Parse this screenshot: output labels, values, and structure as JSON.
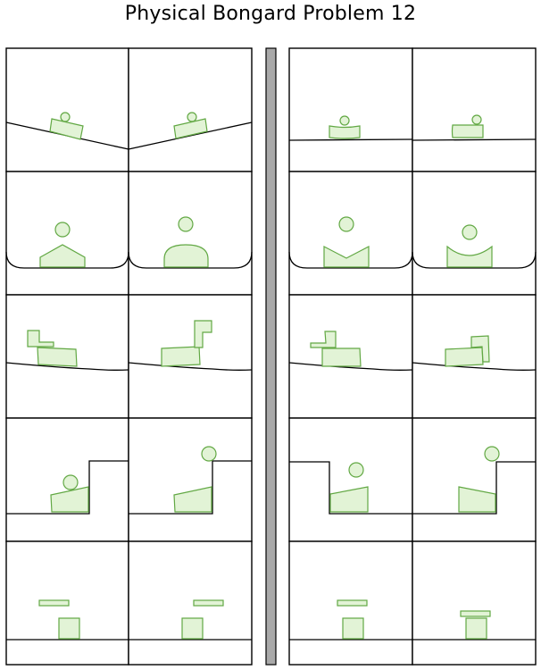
{
  "title": "Physical Bongard Problem 12",
  "colors": {
    "object_fill": "#e2f3d6",
    "object_stroke": "#62a844",
    "divider_fill": "#a9a9a9",
    "line": "#000000",
    "background": "#ffffff"
  },
  "groups": [
    {
      "side": "left",
      "rows": 5,
      "cols": 2
    },
    {
      "side": "right",
      "rows": 5,
      "cols": 2
    }
  ]
}
